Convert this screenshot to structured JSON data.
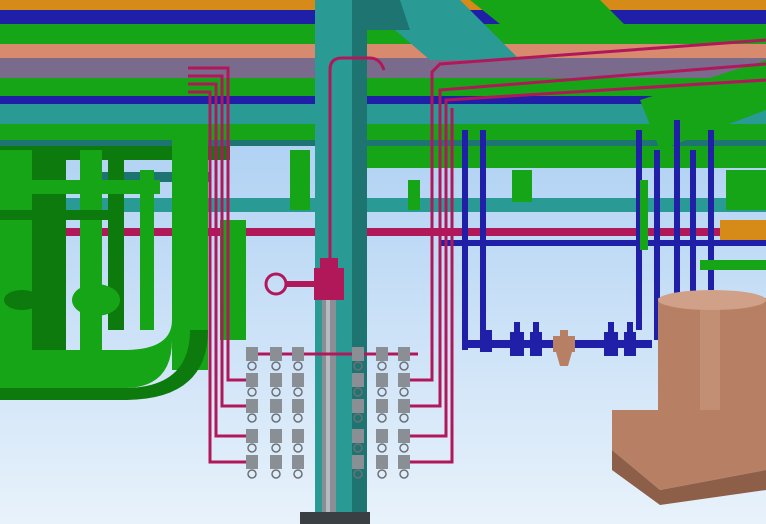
{
  "scene": {
    "kind": "3d-plant-piping-model-render",
    "colors": {
      "sky_top": "#9cc6f1",
      "sky_bottom": "#e8f2fb",
      "steel": "#2a9a95",
      "steel_dark": "#1e7471",
      "pipe_green": "#16a516",
      "pipe_green_dark": "#0d7a0d",
      "pipe_magenta": "#b0185a",
      "pipe_blue": "#1f1fa8",
      "pipe_purple": "#7a6a8c",
      "pipe_salmon": "#d88a6e",
      "pipe_orange": "#d68a18",
      "valve_gray": "#8a8f96",
      "vessel_tan": "#b78064"
    },
    "objects": [
      "steel-column",
      "overhead-pipe-rack",
      "large-green-elbow-pipe",
      "instrument-manifold",
      "handwheel-valve",
      "blue-pipe-valve-train",
      "strainer",
      "vertical-vessel"
    ]
  }
}
